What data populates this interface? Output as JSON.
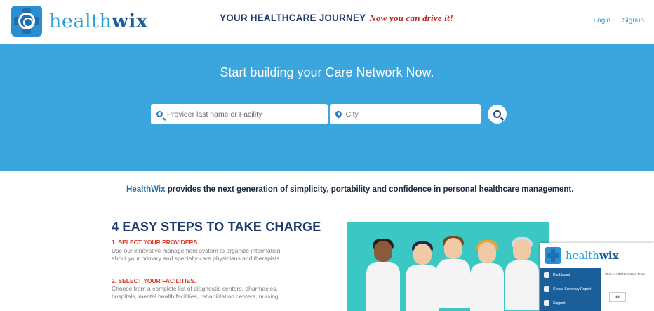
{
  "header": {
    "brand_light": "health",
    "brand_bold": "wix",
    "tagline_main": "YOUR HEALTHCARE JOURNEY",
    "tagline_em": "Now you can drive it!",
    "login": "Login",
    "signup": "Signup"
  },
  "hero": {
    "title": "Start building your Care Network Now.",
    "provider_placeholder": "Provider last name or Facility",
    "city_placeholder": "City",
    "bg_color": "#3aa6dd"
  },
  "intro": {
    "brand": "HealthWix",
    "text": " provides the next generation of simplicity, portability and confidence in personal healthcare management."
  },
  "steps": {
    "title": "4 EASY STEPS TO TAKE CHARGE",
    "items": [
      {
        "heading": "1. SELECT YOUR PROVIDERS.",
        "line1": "Use our innovative management system to organize information",
        "line2": "about your primary and specialty care physicians and therapists"
      },
      {
        "heading": "2. SELECT YOUR FACILITIES.",
        "line1": "Choose from a complete list of diagnostic centers, pharmacies,",
        "line2": "hospitals, mental health facilities, rehabilitation centers, nursing"
      }
    ]
  },
  "preview": {
    "brand_light": "health",
    "brand_bold": "wix",
    "menu": [
      "Dashboard",
      "Create Summary Report",
      "Support"
    ],
    "main_text": "Click to Add New Care Team"
  },
  "colors": {
    "accent": "#2aa0d6",
    "brand_dark": "#1b5f9a",
    "heading": "#1e3b6e",
    "step_red": "#d9392a"
  }
}
